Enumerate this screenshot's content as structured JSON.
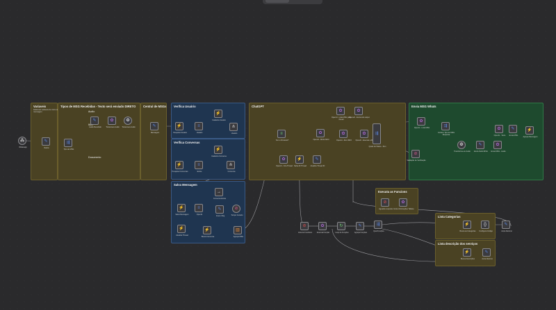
{
  "colors": {
    "canvas_bg": "#2a2a2c",
    "group_yellow": "#4a4223",
    "group_blue": "#1f3550",
    "group_green": "#1e4a2e",
    "icon_green": "#6fd36f",
    "icon_blue": "#5a86e0",
    "icon_pink": "#d05a8a",
    "icon_red": "#e05050",
    "icon_orange": "#e08a3a",
    "wire": "#9a9a9e"
  },
  "groups": {
    "variaveis": {
      "title": "Variaveis",
      "desc": "Definindo variáveis de início da mensagem"
    },
    "tipos": {
      "title": "Tipos de MSG Recebidas - Texto será enviado DIRETO",
      "sub_audio": "Audio",
      "sub_img": "IMG",
      "sub_documento": "Documento"
    },
    "central": {
      "title": "Central de MSGs"
    },
    "verifica_usuario": {
      "title": "Verifica Usuário"
    },
    "verifica_conversas": {
      "title": "Verifica Conversas"
    },
    "salva_mensagem": {
      "title": "Salva Mensagem"
    },
    "chatgpt": {
      "title": "ChatGPT"
    },
    "envia_msg": {
      "title": "Envia MSG Whats"
    },
    "executa_funcoes": {
      "title": "Executa as Funcions"
    },
    "lista_categorias": {
      "title": "Lista Categorias"
    },
    "lista_descricao": {
      "title": "Lista descrição dos serviços"
    }
  },
  "nodes": {
    "whatsapp": {
      "label": "Whatsapp",
      "icon": "webhook-icon"
    },
    "dados": {
      "label": "Dados",
      "icon": "edit-icon"
    },
    "tipo_de_msg": {
      "label": "Tipo de MSG",
      "icon": "switch-icon"
    },
    "audio_1": {
      "label": "Audio Recebido",
      "icon": "edit-icon"
    },
    "audio_2": {
      "label": "Transcreve Audio",
      "icon": "openai-icon"
    },
    "audio_3": {
      "label": "Transcreve Audio",
      "icon": "openai-icon"
    },
    "mensagem": {
      "label": "Mensagem",
      "icon": "edit-icon"
    },
    "vu_1": {
      "label": "Pesquisa Usuário",
      "icon": "bolt-icon"
    },
    "vu_2": {
      "label": "Usuário",
      "icon": "code-icon"
    },
    "vu_3": {
      "label": "Cadastra Usuário",
      "icon": "bolt-icon"
    },
    "vu_4": {
      "label": "Usuário",
      "icon": "merge-icon"
    },
    "vc_1": {
      "label": "Pesquisa Conversas",
      "icon": "bolt-icon"
    },
    "vc_2": {
      "label": "Existe",
      "icon": "code-icon"
    },
    "vc_3": {
      "label": "Cadastra Conversa",
      "icon": "bolt-icon"
    },
    "vc_4": {
      "label": "Conversa",
      "icon": "merge-icon"
    },
    "sm_1": {
      "label": "Salva Mensagem",
      "icon": "bolt-icon"
    },
    "sm_2": {
      "label": "OpenAI",
      "icon": "code-icon"
    },
    "sm_3": {
      "label": "Conversa Existe",
      "icon": "arrow-icon"
    },
    "sm_4": {
      "label": "Insere Msg",
      "icon": "edit-icon"
    },
    "sm_5": {
      "label": "Tempo Cenário",
      "icon": "stop-icon"
    },
    "sm_6": {
      "label": "Atualiza Thread",
      "icon": "bolt-icon"
    },
    "sm_7": {
      "label": "Busca Conversa",
      "icon": "bolt-icon"
    },
    "sm_8": {
      "label": "Agrupa MSG",
      "icon": "db-icon"
    },
    "gpt_1": {
      "label": "Tem o ID Assist?",
      "icon": "code-icon"
    },
    "gpt_2": {
      "label": "OpenAI - Cria Thread",
      "icon": "openai-icon"
    },
    "gpt_3": {
      "label": "Salva ID Thread",
      "icon": "bolt-icon"
    },
    "gpt_4": {
      "label": "Atualiza Thread ID",
      "icon": "edit-icon"
    },
    "gpt_5": {
      "label": "OpenAI - MSG INFO",
      "icon": "openai-icon"
    },
    "gpt_6": {
      "label": "OpenAI - Lista MSG para thread",
      "icon": "openai-icon"
    },
    "gpt_7": {
      "label": "OpenAI - Envia tool output",
      "icon": "openai-icon"
    },
    "gpt_8": {
      "label": "OpenAI - Run INFO",
      "icon": "openai-icon"
    },
    "gpt_9": {
      "label": "OpenAI - Executa a Run",
      "icon": "openai-icon"
    },
    "gpt_10": {
      "label": "Qualo de Status - Run",
      "icon": "switch-icon"
    },
    "gpt_11": {
      "label": "Validação de Verificação",
      "icon": "stop-icon"
    },
    "env_1": {
      "label": "OpenAI - Lista MSG",
      "icon": "openai-icon"
    },
    "env_2": {
      "label": "Confere Tipo de MSG Resposta",
      "icon": "switch-icon"
    },
    "env_3": {
      "label": "OpenAI - Texto",
      "icon": "openai-icon"
    },
    "env_4": {
      "label": "Envia MSG",
      "icon": "edit-icon"
    },
    "env_5": {
      "label": "Transforma em Audio",
      "icon": "openai-icon"
    },
    "env_6": {
      "label": "Envia Áudio MSG",
      "icon": "edit-icon"
    },
    "env_7": {
      "label": "Envia MSG - Audio",
      "icon": "openai-icon"
    },
    "env_8": {
      "label": "Agrupa Mensagem",
      "icon": "bolt-icon"
    },
    "exe_1": {
      "label": "Aguarda resposta",
      "icon": "stop-icon"
    },
    "exe_2": {
      "label": "Envia informações Tablete",
      "icon": "openai-icon"
    },
    "low_1": {
      "label": "Lista de Functions",
      "icon": "stop-icon"
    },
    "low_2": {
      "label": "Executa Função",
      "icon": "openai-icon"
    },
    "low_3": {
      "label": "Loop de Funções",
      "icon": "loop-icon"
    },
    "low_4": {
      "label": "Agrupa Funções",
      "icon": "edit-icon"
    },
    "low_5": {
      "label": "Qual Funções",
      "icon": "switch-icon"
    },
    "cat_1": {
      "label": "Busca as Categorias",
      "icon": "bolt-icon"
    },
    "cat_2": {
      "label": "Configura Código",
      "icon": "braces-icon"
    },
    "cat_3": {
      "label": "Junta Retorno",
      "icon": "edit-icon"
    },
    "desc_1": {
      "label": "Busca Descrições",
      "icon": "bolt-icon"
    },
    "desc_2": {
      "label": "Junta Retorno",
      "icon": "edit-icon"
    }
  }
}
